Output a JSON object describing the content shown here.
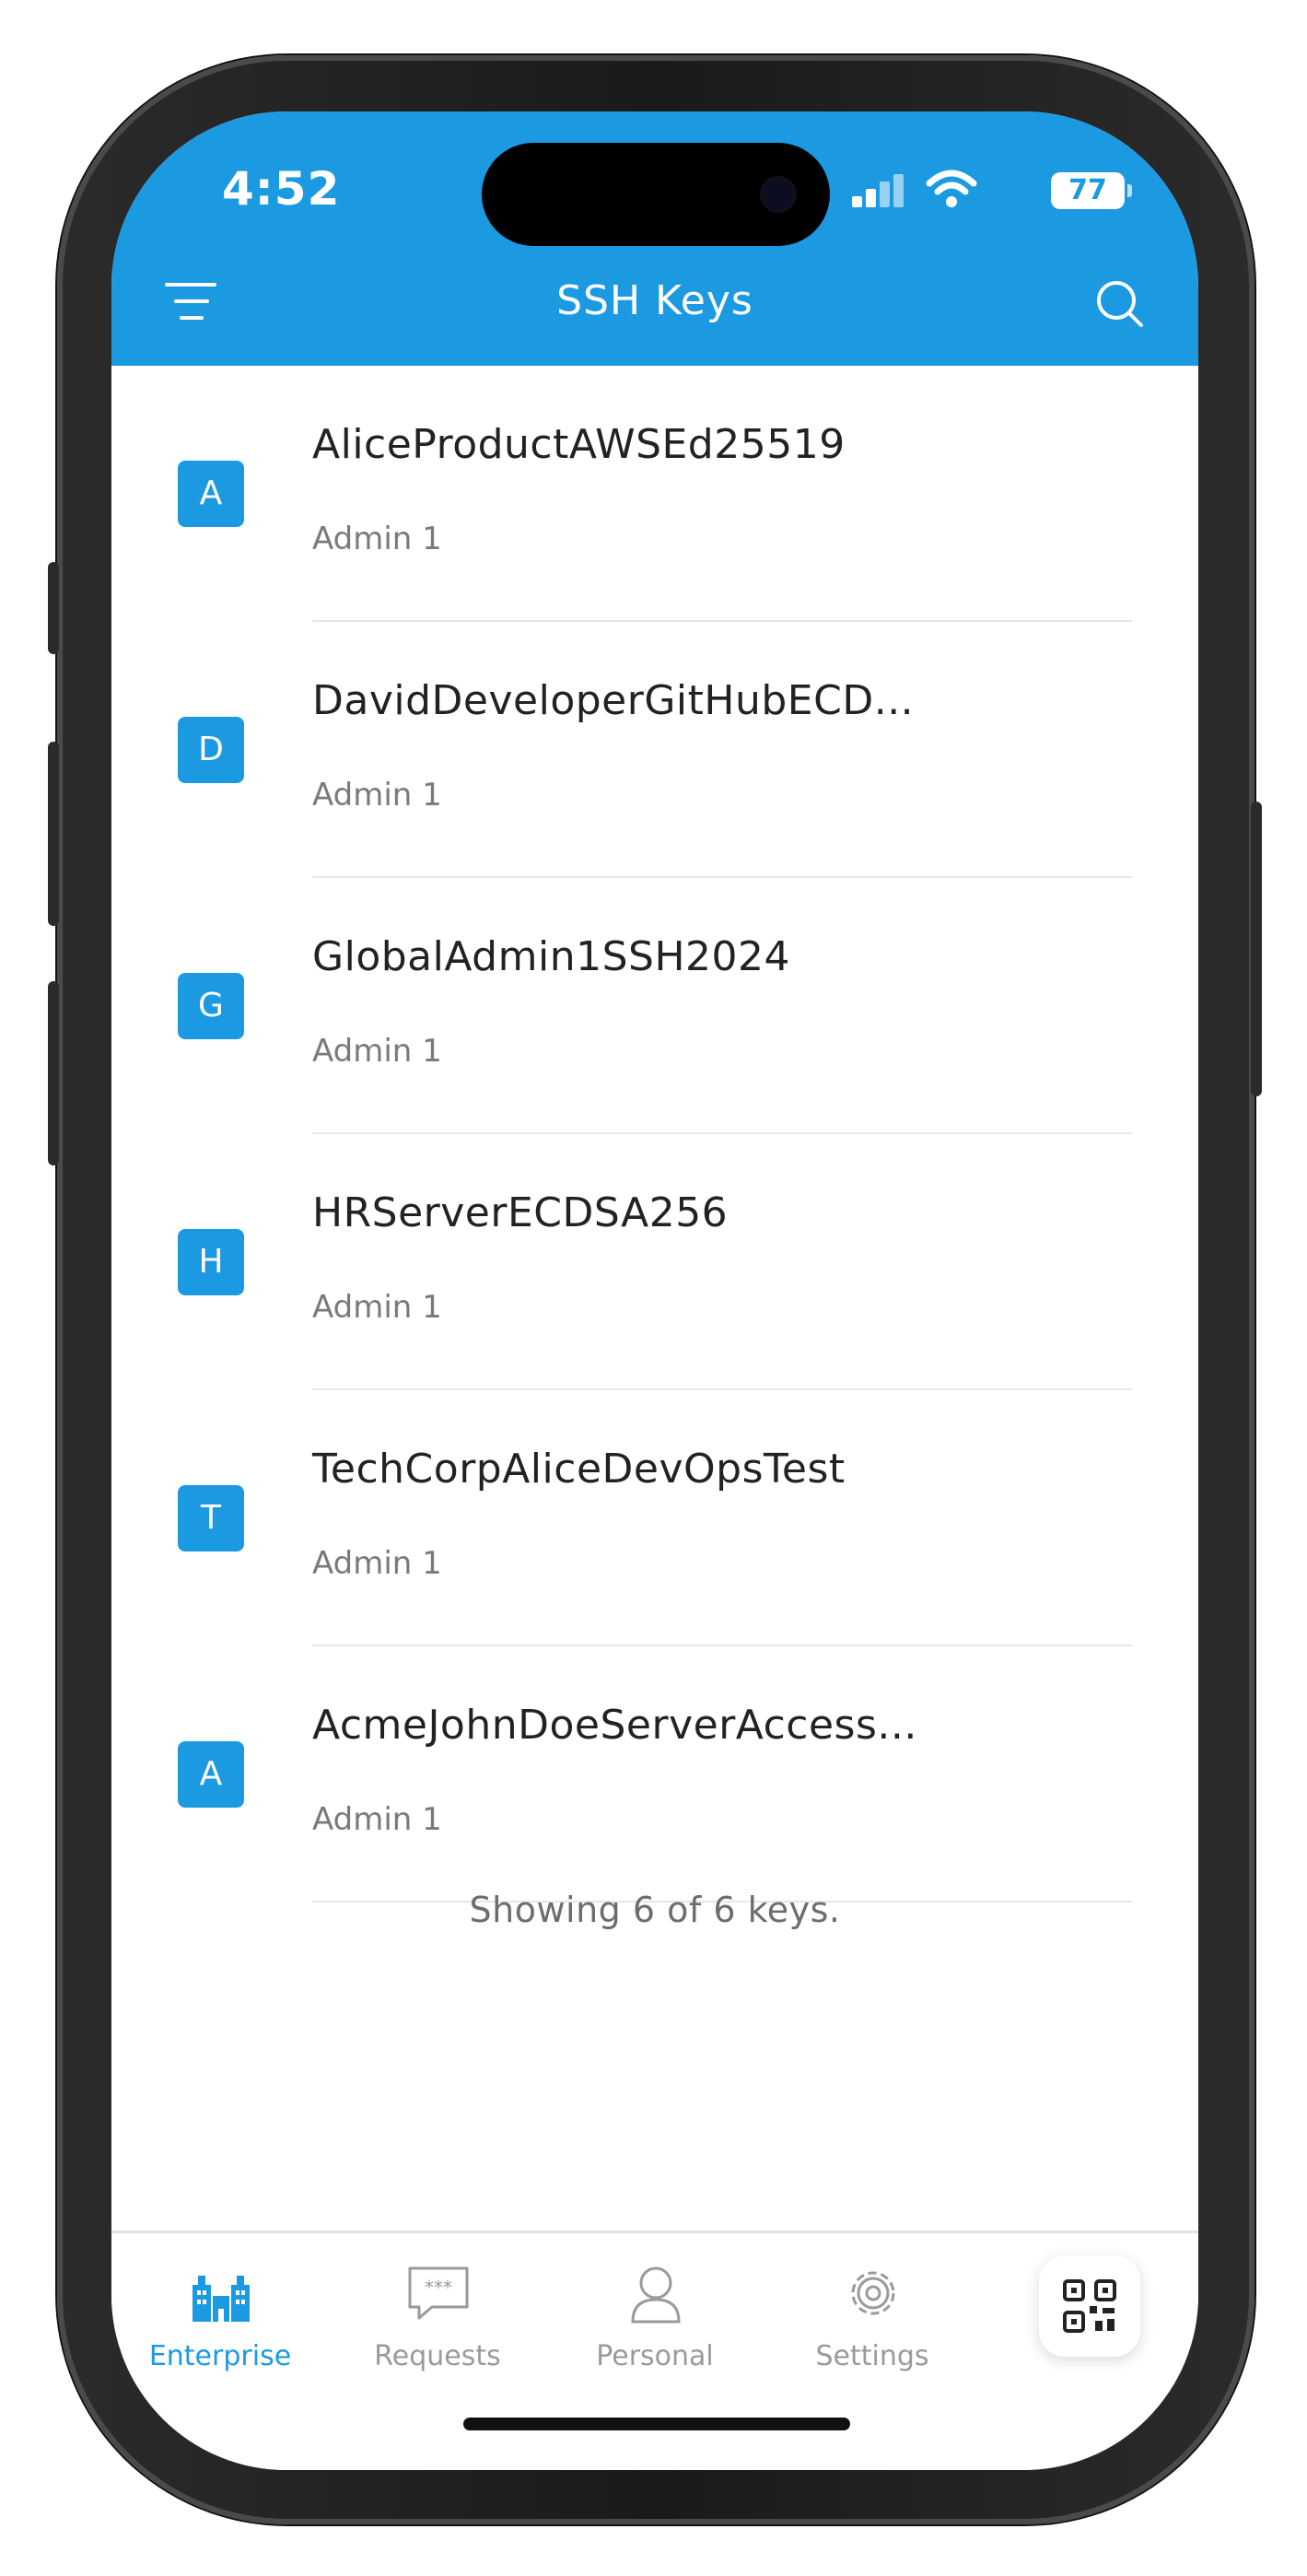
{
  "status_bar": {
    "time": "4:52",
    "battery": "77"
  },
  "header": {
    "title": "SSH Keys"
  },
  "keys": [
    {
      "initial": "A",
      "name": "AliceProductAWSEd25519",
      "subtitle": "Admin 1"
    },
    {
      "initial": "D",
      "name": "DavidDeveloperGitHubECD...",
      "subtitle": "Admin 1"
    },
    {
      "initial": "G",
      "name": "GlobalAdmin1SSH2024",
      "subtitle": "Admin 1"
    },
    {
      "initial": "H",
      "name": "HRServerECDSA256",
      "subtitle": "Admin 1"
    },
    {
      "initial": "T",
      "name": "TechCorpAliceDevOpsTest",
      "subtitle": "Admin 1"
    },
    {
      "initial": "A",
      "name": "AcmeJohnDoeServerAccess...",
      "subtitle": "Admin 1"
    }
  ],
  "footer_note": "Showing 6 of 6 keys.",
  "tabbar": {
    "tabs": [
      {
        "label": "Enterprise",
        "icon": "buildings-icon",
        "active": true
      },
      {
        "label": "Requests",
        "icon": "chat-bubble-icon",
        "active": false
      },
      {
        "label": "Personal",
        "icon": "person-icon",
        "active": false
      },
      {
        "label": "Settings",
        "icon": "gear-icon",
        "active": false
      }
    ],
    "qr_icon": "qr-code-icon"
  },
  "colors": {
    "accent": "#1c9ae1",
    "text_primary": "#222222",
    "text_secondary": "#7a7a7a",
    "tab_inactive": "#9a9a9a"
  }
}
